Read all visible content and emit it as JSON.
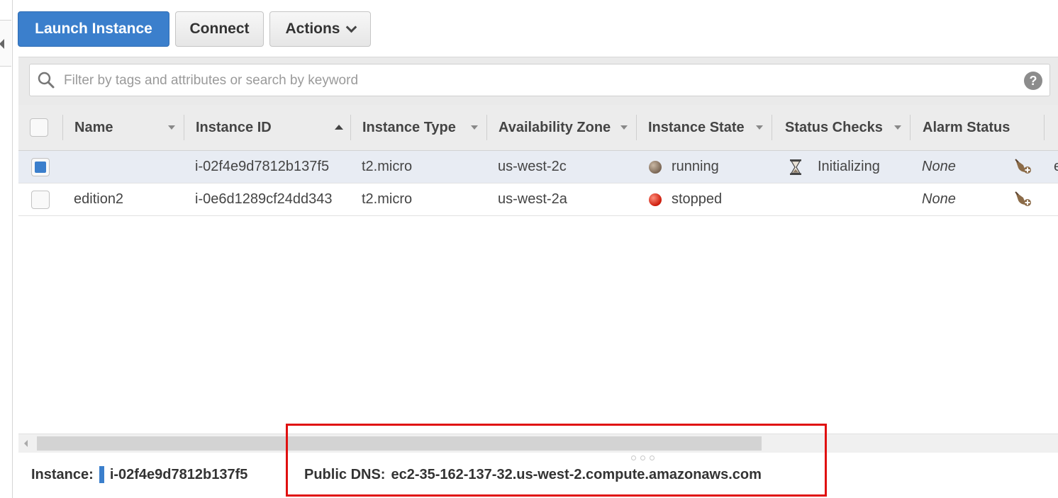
{
  "toolbar": {
    "launch_label": "Launch Instance",
    "connect_label": "Connect",
    "actions_label": "Actions"
  },
  "filter": {
    "placeholder": "Filter by tags and attributes or search by keyword",
    "help_glyph": "?"
  },
  "table": {
    "columns": [
      {
        "label": "Name",
        "sort": "none"
      },
      {
        "label": "Instance ID",
        "sort": "ascending"
      },
      {
        "label": "Instance Type",
        "sort": "none"
      },
      {
        "label": "Availability Zone",
        "sort": "none"
      },
      {
        "label": "Instance State",
        "sort": "none"
      },
      {
        "label": "Status Checks",
        "sort": "none"
      },
      {
        "label": "Alarm Status",
        "sort": "none"
      }
    ],
    "rows": [
      {
        "selected": true,
        "name": "",
        "instance_id": "i-02f4e9d7812b137f5",
        "instance_type": "t2.micro",
        "availability_zone": "us-west-2c",
        "instance_state": "running",
        "state_color": "#7a6654",
        "status_checks": "Initializing",
        "status_icon": "hourglass-icon",
        "alarm_status": "None",
        "overflow_text": "e"
      },
      {
        "selected": false,
        "name": "edition2",
        "instance_id": "i-0e6d1289cf24dd343",
        "instance_type": "t2.micro",
        "availability_zone": "us-west-2a",
        "instance_state": "stopped",
        "state_color": "#cc1b0b",
        "status_checks": "",
        "alarm_status": "None",
        "overflow_text": ""
      }
    ]
  },
  "details": {
    "instance_label": "Instance:",
    "instance_id": "i-02f4e9d7812b137f5",
    "public_dns_label": "Public DNS:",
    "public_dns_value": "ec2-35-162-137-32.us-west-2.compute.amazonaws.com"
  },
  "colors": {
    "primary": "#3b7fcc",
    "highlight_box": "#e01010"
  }
}
